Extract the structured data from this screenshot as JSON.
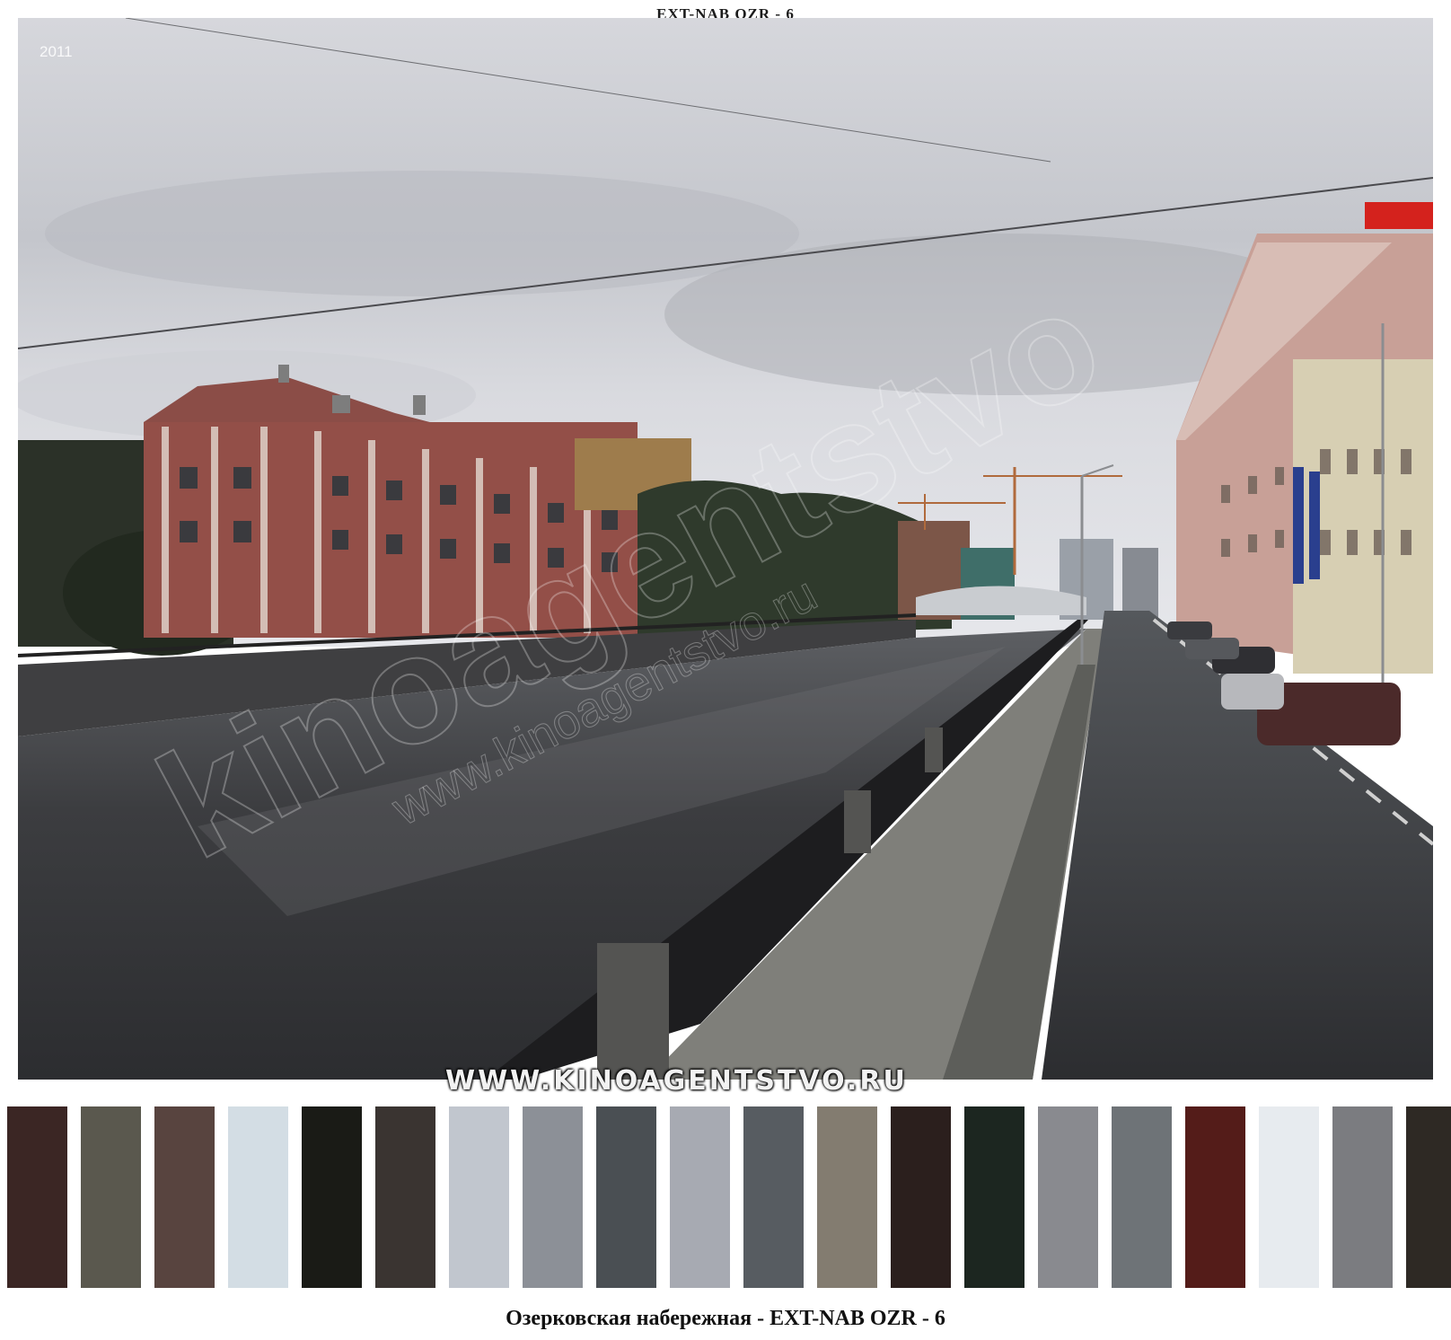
{
  "header": {
    "title": "EXT-NAB OZR - 6"
  },
  "photo": {
    "year_stamp": "2011",
    "website": "WWW.KINOAGENTSTVO.RU",
    "watermark_text": "kinoagentstvo",
    "watermark_url": "www.kinoagentstvo.ru"
  },
  "palette": {
    "colors": [
      "#3b2624",
      "#5a584e",
      "#58443f",
      "#d3dde4",
      "#1a1b16",
      "#3a3431",
      "#c1c6ce",
      "#8c9097",
      "#4a4f53",
      "#a7aab2",
      "#575c61",
      "#837c70",
      "#2b1f1d",
      "#1c2620",
      "#898a8f",
      "#6e7377",
      "#541c19",
      "#e7ebef",
      "#7b7c80",
      "#2e2924"
    ]
  },
  "caption": {
    "text": "Озерковская набережная - EXT-NAB OZR - 6"
  }
}
